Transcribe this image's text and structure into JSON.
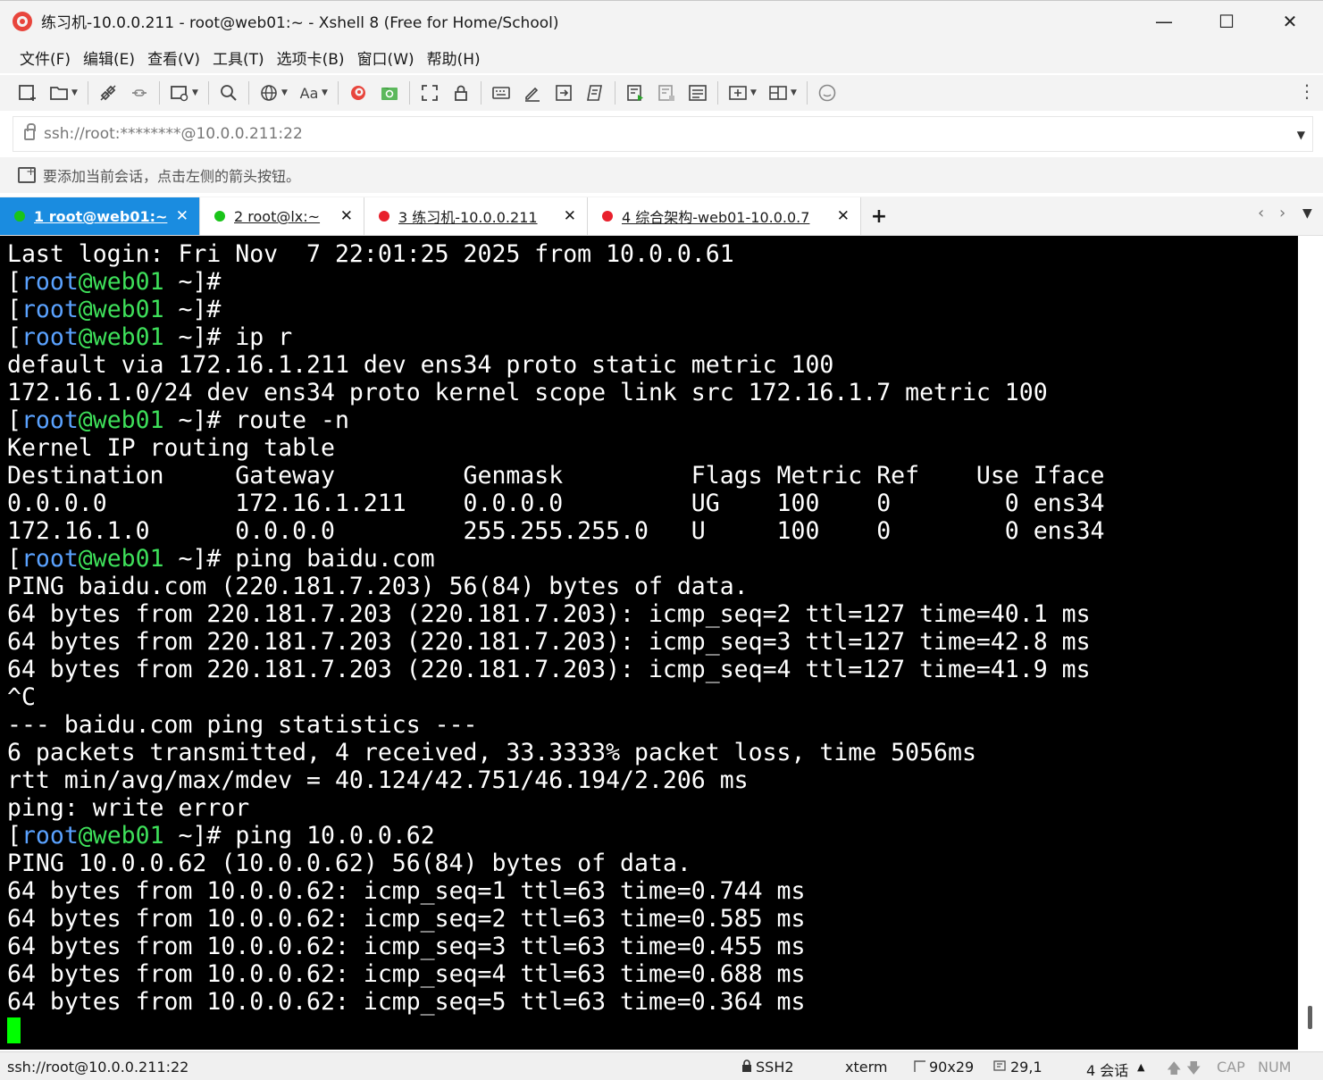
{
  "window": {
    "title": "练习机-10.0.0.211 - root@web01:~ - Xshell 8 (Free for Home/School)",
    "controls": {
      "minimize": "—",
      "maximize": "☐",
      "close": "✕"
    }
  },
  "menu": [
    "文件(F)",
    "编辑(E)",
    "查看(V)",
    "工具(T)",
    "选项卡(B)",
    "窗口(W)",
    "帮助(H)"
  ],
  "toolbar": {
    "aa_label": "Aa"
  },
  "address": {
    "text": "ssh://root:********@10.0.0.211:22"
  },
  "hint": {
    "text": "要添加当前会话，点击左侧的箭头按钮。"
  },
  "tabs": [
    {
      "label": "1 root@web01:~",
      "dot_color": "#19c419",
      "active": true
    },
    {
      "label": "2 root@lx:~",
      "dot_color": "#19c419",
      "active": false
    },
    {
      "label": "3 练习机-10.0.0.211",
      "dot_color": "#e8202c",
      "active": false
    },
    {
      "label": "4 综合架构-web01-10.0.0.7",
      "dot_color": "#e8202c",
      "active": false
    }
  ],
  "terminal": {
    "prompt": {
      "open": "[",
      "user": "root",
      "at": "@",
      "host": "web01",
      "rest": " ~]# "
    },
    "lines": [
      {
        "text": "Last login: Fri Nov  7 22:01:25 2025 from 10.0.0.61"
      },
      {
        "prompt": true,
        "text": ""
      },
      {
        "prompt": true,
        "text": ""
      },
      {
        "prompt": true,
        "text": "ip r"
      },
      {
        "text": "default via 172.16.1.211 dev ens34 proto static metric 100"
      },
      {
        "text": "172.16.1.0/24 dev ens34 proto kernel scope link src 172.16.1.7 metric 100"
      },
      {
        "prompt": true,
        "text": "route -n"
      },
      {
        "text": "Kernel IP routing table"
      },
      {
        "text": "Destination     Gateway         Genmask         Flags Metric Ref    Use Iface"
      },
      {
        "text": "0.0.0.0         172.16.1.211    0.0.0.0         UG    100    0        0 ens34"
      },
      {
        "text": "172.16.1.0      0.0.0.0         255.255.255.0   U     100    0        0 ens34"
      },
      {
        "prompt": true,
        "text": "ping baidu.com"
      },
      {
        "text": "PING baidu.com (220.181.7.203) 56(84) bytes of data."
      },
      {
        "text": "64 bytes from 220.181.7.203 (220.181.7.203): icmp_seq=2 ttl=127 time=40.1 ms"
      },
      {
        "text": "64 bytes from 220.181.7.203 (220.181.7.203): icmp_seq=3 ttl=127 time=42.8 ms"
      },
      {
        "text": "64 bytes from 220.181.7.203 (220.181.7.203): icmp_seq=4 ttl=127 time=41.9 ms"
      },
      {
        "text": "^C"
      },
      {
        "text": "--- baidu.com ping statistics ---"
      },
      {
        "text": "6 packets transmitted, 4 received, 33.3333% packet loss, time 5056ms"
      },
      {
        "text": "rtt min/avg/max/mdev = 40.124/42.751/46.194/2.206 ms"
      },
      {
        "text": "ping: write error"
      },
      {
        "prompt": true,
        "text": "ping 10.0.0.62"
      },
      {
        "text": "PING 10.0.0.62 (10.0.0.62) 56(84) bytes of data."
      },
      {
        "text": "64 bytes from 10.0.0.62: icmp_seq=1 ttl=63 time=0.744 ms"
      },
      {
        "text": "64 bytes from 10.0.0.62: icmp_seq=2 ttl=63 time=0.585 ms"
      },
      {
        "text": "64 bytes from 10.0.0.62: icmp_seq=3 ttl=63 time=0.455 ms"
      },
      {
        "text": "64 bytes from 10.0.0.62: icmp_seq=4 ttl=63 time=0.688 ms"
      },
      {
        "text": "64 bytes from 10.0.0.62: icmp_seq=5 ttl=63 time=0.364 ms"
      }
    ]
  },
  "status": {
    "connection": "ssh://root@10.0.0.211:22",
    "protocol": "SSH2",
    "term": "xterm",
    "size": "90x29",
    "position": "29,1",
    "sessions": "4 会话",
    "cap": "CAP",
    "num": "NUM"
  }
}
